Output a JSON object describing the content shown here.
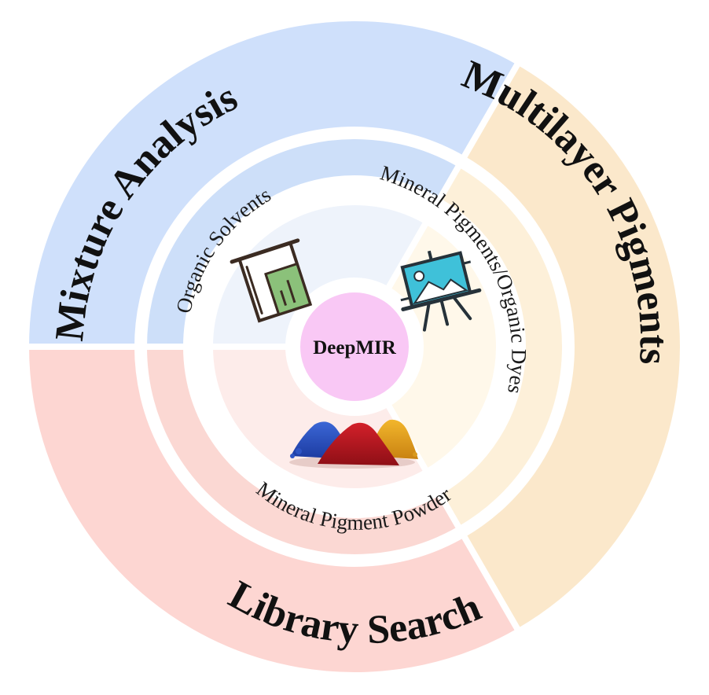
{
  "center": {
    "label": "DeepMIR",
    "color": "#f9c8f5"
  },
  "sectors": [
    {
      "id": "mixture",
      "title": "Mixture Analysis",
      "subtitle": "Organic Solvents",
      "icon": "beaker-icon",
      "colors": {
        "outer": "#cfe0fb",
        "mid": "#cddff9",
        "inner": "#eef3fb"
      }
    },
    {
      "id": "multilayer",
      "title": "Multilayer Pigments",
      "subtitle": "Mineral Pigments/Organic Dyes",
      "icon": "easel-painting-icon",
      "colors": {
        "outer": "#fbe8cb",
        "mid": "#fdf0d9",
        "inner": "#fff8ea"
      }
    },
    {
      "id": "library",
      "title": "Library Search",
      "subtitle": "Mineral Pigment Powder",
      "icon": "pigment-powder-icon",
      "colors": {
        "outer": "#fdd6d2",
        "mid": "#fbd8d3",
        "inner": "#fdecea"
      }
    }
  ]
}
